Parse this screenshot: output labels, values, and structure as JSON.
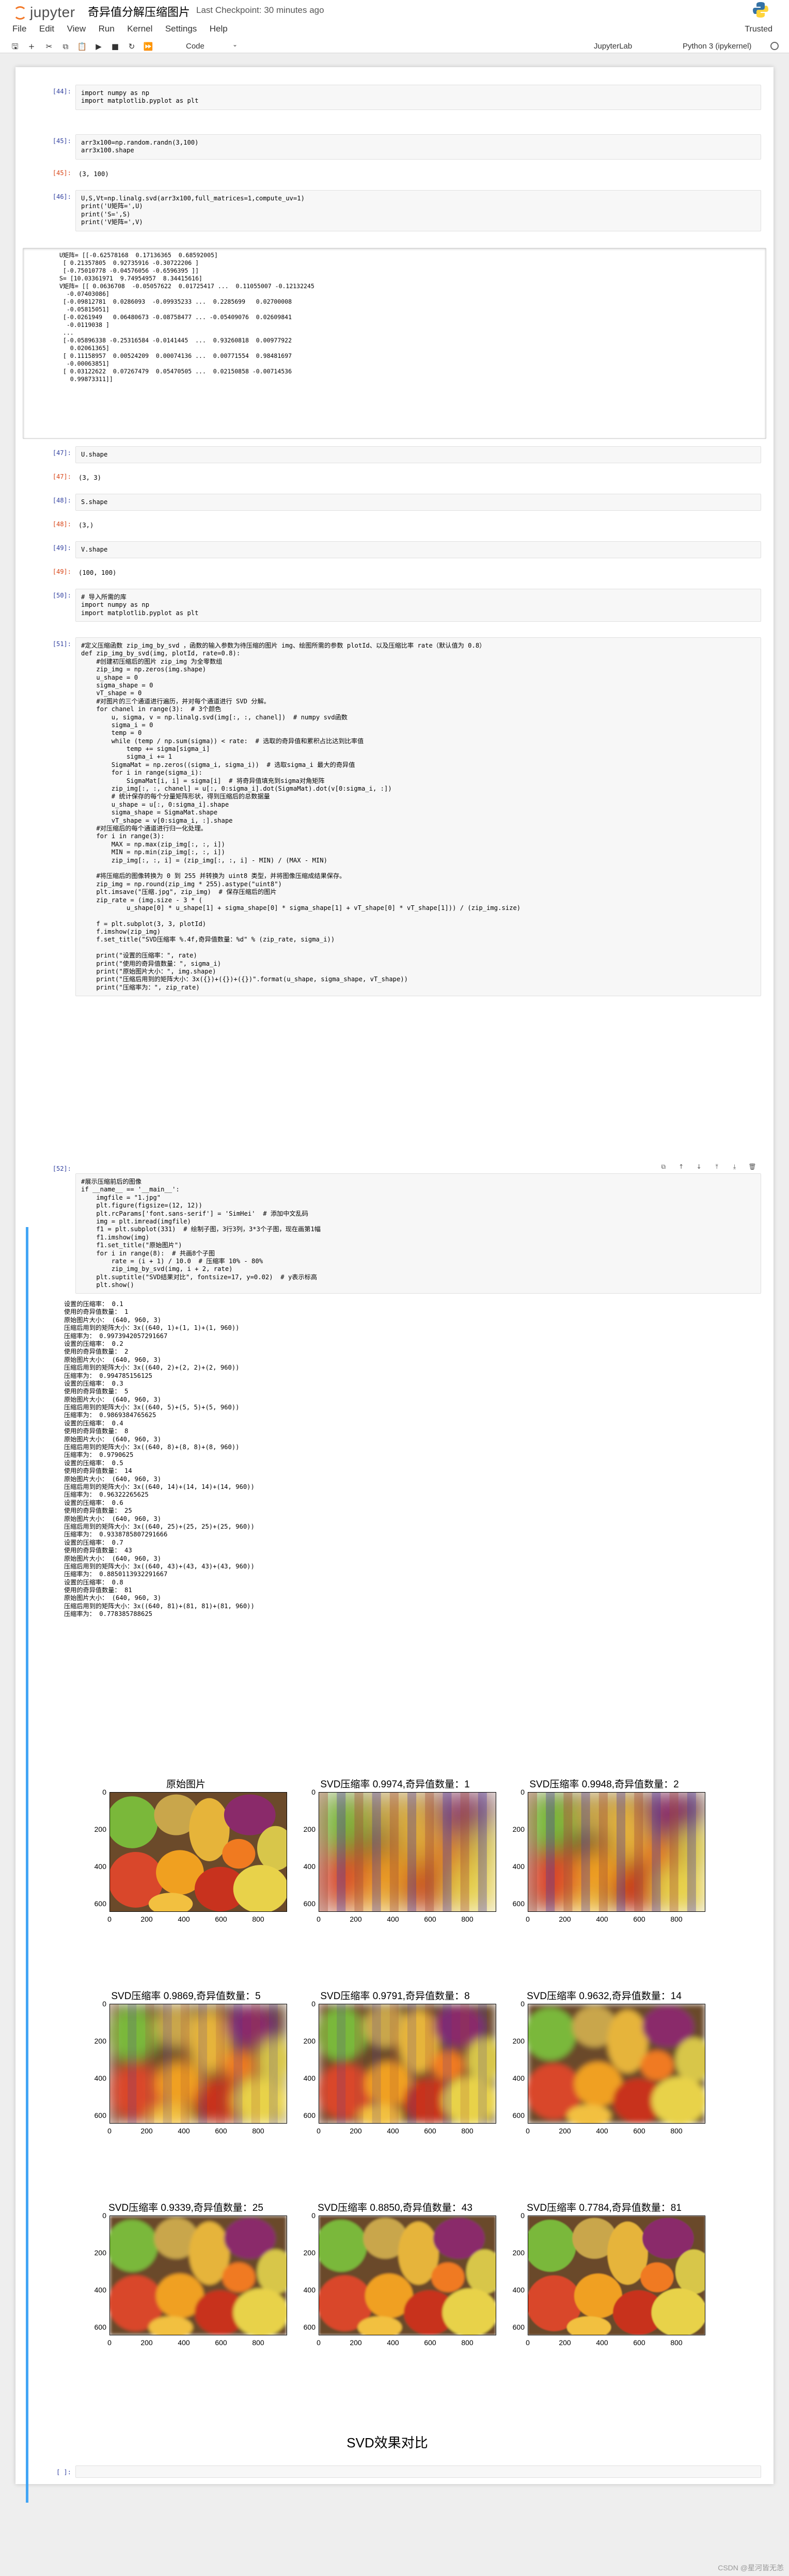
{
  "header": {
    "logo_text": "jupyter",
    "title": "奇异值分解压缩图片",
    "checkpoint": "Last Checkpoint: 30 minutes ago",
    "trusted": "Trusted",
    "menu": [
      "File",
      "Edit",
      "View",
      "Run",
      "Kernel",
      "Settings",
      "Help"
    ],
    "cell_type": "Code",
    "jupyterlab_link": "JupyterLab",
    "kernel": "Python 3 (ipykernel)"
  },
  "cells": {
    "c1": {
      "prompt": "[44]:",
      "lines": [
        "import numpy as np",
        "import matplotlib.pyplot as plt"
      ]
    },
    "c2": {
      "prompt": "[45]:",
      "lines": [
        "arr3x100=np.random.randn(3,100)",
        "arr3x100.shape"
      ]
    },
    "c2o": {
      "prompt": "[45]:",
      "lines": [
        "(3, 100)"
      ]
    },
    "c3": {
      "prompt": "[46]:",
      "lines": [
        "U,S,Vt=np.linalg.svd(arr3x100,full_matrices=1,compute_uv=1)",
        "print('U矩阵=',U)",
        "print('S=',S)",
        "print('V矩阵=',V)"
      ]
    },
    "c3o": {
      "lines": [
        "U矩阵= [[-0.62578168  0.17136365  0.68592005]",
        " [ 0.21357805  0.92735916 -0.30722206 ]",
        " [-0.75010778 -0.04576056 -0.6596395 ]]",
        "S= [10.03361971  9.74954957  8.34415616]",
        "V矩阵= [[ 0.0636708  -0.05057622  0.01725417 ...  0.11055007 -0.12132245",
        "  -0.07403086]",
        " [-0.09812781  0.0286093  -0.09935233 ...  0.2285699   0.02700008",
        "  -0.05815051]",
        " [-0.0261949   0.06480673 -0.08758477 ... -0.05409076  0.02609841",
        "  -0.0119038 ]",
        " ...",
        " [-0.05896338 -0.25316584 -0.0141445  ...  0.93260818  0.00977922",
        "   0.02061365]",
        " [ 0.11158957  0.00524209  0.00074136 ...  0.00771554  0.98481697",
        "  -0.00063851]",
        " [ 0.03122622  0.07267479  0.05470505 ...  0.02150858 -0.00714536",
        "   0.99873311]]"
      ]
    },
    "c4": {
      "prompt": "[47]:",
      "lines": [
        "U.shape"
      ]
    },
    "c4o": {
      "prompt": "[47]:",
      "lines": [
        "(3, 3)"
      ]
    },
    "c5": {
      "prompt": "[48]:",
      "lines": [
        "S.shape"
      ]
    },
    "c5o": {
      "prompt": "[48]:",
      "lines": [
        "(3,)"
      ]
    },
    "c6": {
      "prompt": "[49]:",
      "lines": [
        "V.shape"
      ]
    },
    "c6o": {
      "prompt": "[49]:",
      "lines": [
        "(100, 100)"
      ]
    },
    "c7": {
      "prompt": "[50]:",
      "lines": [
        "# 导入所需的库",
        "import numpy as np",
        "import matplotlib.pyplot as plt"
      ]
    },
    "c8": {
      "prompt": "[51]:",
      "lines": [
        "#定义压缩函数 zip_img_by_svd ，函数的输入参数为待压缩的图片 img、绘图所需的参数 plotId、以及压缩比率 rate（默认值为 0.8）",
        "def zip_img_by_svd(img, plotId, rate=0.8):",
        "    #创建初压缩后的图片 zip_img 为全零数组",
        "    zip_img = np.zeros(img.shape)",
        "    u_shape = 0",
        "    sigma_shape = 0",
        "    vT_shape = 0",
        "    #对图片的三个通道进行遍历，并对每个通道进行 SVD 分解。",
        "    for chanel in range(3):  # 3个颜色",
        "        u, sigma, v = np.linalg.svd(img[:, :, chanel])  # numpy svd函数",
        "        sigma_i = 0",
        "        temp = 0",
        "        while (temp / np.sum(sigma)) < rate:  # 选取的奇异值和累积占比达到比率值",
        "            temp += sigma[sigma_i]",
        "            sigma_i += 1",
        "        SigmaMat = np.zeros((sigma_i, sigma_i))  # 选取sigma_i 最大的奇异值",
        "        for i in range(sigma_i):",
        "            SigmaMat[i, i] = sigma[i]  # 将奇异值填充到sigma对角矩阵",
        "        zip_img[:, :, chanel] = u[:, 0:sigma_i].dot(SigmaMat).dot(v[0:sigma_i, :])",
        "        # 统计保存的每个分量矩阵形状，得到压缩后的总数据量",
        "        u_shape = u[:, 0:sigma_i].shape",
        "        sigma_shape = SigmaMat.shape",
        "        vT_shape = v[0:sigma_i, :].shape",
        "    #对压缩后的每个通道进行归一化处理。",
        "    for i in range(3):",
        "        MAX = np.max(zip_img[:, :, i])",
        "        MIN = np.min(zip_img[:, :, i])",
        "        zip_img[:, :, i] = (zip_img[:, :, i] - MIN) / (MAX - MIN)",
        "",
        "    #将压缩后的图像转换为 0 到 255 并转换为 uint8 类型，并将图像压缩成结果保存。",
        "    zip_img = np.round(zip_img * 255).astype(\"uint8\")",
        "    plt.imsave(\"压缩.jpg\", zip_img)  # 保存压缩后的图片",
        "    zip_rate = (img.size - 3 * (",
        "            u_shape[0] * u_shape[1] + sigma_shape[0] * sigma_shape[1] + vT_shape[0] * vT_shape[1])) / (zip_img.size)",
        "",
        "    f = plt.subplot(3, 3, plotId)",
        "    f.imshow(zip_img)",
        "    f.set_title(\"SVD压缩率 %.4f,奇异值数量：%d\" % (zip_rate, sigma_i))",
        "",
        "    print(\"设置的压缩率：\", rate)",
        "    print(\"使用的奇异值数量：\", sigma_i)",
        "    print(\"原始图片大小：\", img.shape)",
        "    print(\"压缩后用到的矩阵大小：3x({})+({})+({})\".format(u_shape, sigma_shape, vT_shape))",
        "    print(\"压缩率为：\", zip_rate)"
      ]
    },
    "c9": {
      "prompt": "[52]:",
      "lines": [
        "#展示压缩前后的图像",
        "if __name__ == '__main__':",
        "    imgfile = \"1.jpg\"",
        "    plt.figure(figsize=(12, 12))",
        "    plt.rcParams['font.sans-serif'] = 'SimHei'  # 添加中文乱码",
        "    img = plt.imread(imgfile)",
        "    f1 = plt.subplot(331)  # 绘制子图，3行3列，3*3个子图，现在画第1幅",
        "    f1.imshow(img)",
        "    f1.set_title(\"原始图片\")",
        "    for i in range(8):  # 共画8个子图",
        "        rate = (i + 1) / 10.0  # 压缩率 10% - 80%",
        "        zip_img_by_svd(img, i + 2, rate)",
        "    plt.suptitle(\"SVD结果对比\", fontsize=17, y=0.02)  # y表示标高",
        "    plt.show()"
      ]
    },
    "c9o": {
      "lines": [
        "设置的压缩率： 0.1",
        "使用的奇异值数量： 1",
        "原始图片大小： (640, 960, 3)",
        "压缩后用到的矩阵大小：3x((640, 1)+(1, 1)+(1, 960))",
        "压缩率为： 0.9973942057291667",
        "设置的压缩率： 0.2",
        "使用的奇异值数量： 2",
        "原始图片大小： (640, 960, 3)",
        "压缩后用到的矩阵大小：3x((640, 2)+(2, 2)+(2, 960))",
        "压缩率为： 0.994785156125",
        "设置的压缩率： 0.3",
        "使用的奇异值数量： 5",
        "原始图片大小： (640, 960, 3)",
        "压缩后用到的矩阵大小：3x((640, 5)+(5, 5)+(5, 960))",
        "压缩率为： 0.9869384765625",
        "设置的压缩率： 0.4",
        "使用的奇异值数量： 8",
        "原始图片大小： (640, 960, 3)",
        "压缩后用到的矩阵大小：3x((640, 8)+(8, 8)+(8, 960))",
        "压缩率为： 0.9790625",
        "设置的压缩率： 0.5",
        "使用的奇异值数量： 14",
        "原始图片大小： (640, 960, 3)",
        "压缩后用到的矩阵大小：3x((640, 14)+(14, 14)+(14, 960))",
        "压缩率为： 0.96322265625",
        "设置的压缩率： 0.6",
        "使用的奇异值数量： 25",
        "原始图片大小： (640, 960, 3)",
        "压缩后用到的矩阵大小：3x((640, 25)+(25, 25)+(25, 960))",
        "压缩率为： 0.9338785807291666",
        "设置的压缩率： 0.7",
        "使用的奇异值数量： 43",
        "原始图片大小： (640, 960, 3)",
        "压缩后用到的矩阵大小：3x((640, 43)+(43, 43)+(43, 960))",
        "压缩率为： 0.8850113932291667",
        "设置的压缩率： 0.8",
        "使用的奇异值数量： 81",
        "原始图片大小： (640, 960, 3)",
        "压缩后用到的矩阵大小：3x((640, 81)+(81, 81)+(81, 960))",
        "压缩率为： 0.778385788625"
      ]
    },
    "c10": {
      "prompt": "[ ]:"
    }
  },
  "figure": {
    "suptitle": "SVD效果对比",
    "subplots": [
      {
        "title": "原始图片",
        "blur": 0
      },
      {
        "title": "SVD压缩率 0.9974,奇异值数量：1",
        "blur": 26
      },
      {
        "title": "SVD压缩率 0.9948,奇异值数量：2",
        "blur": 20
      },
      {
        "title": "SVD压缩率 0.9869,奇异值数量：5",
        "blur": 12
      },
      {
        "title": "SVD压缩率 0.9791,奇异值数量：8",
        "blur": 8
      },
      {
        "title": "SVD压缩率 0.9632,奇异值数量：14",
        "blur": 5
      },
      {
        "title": "SVD压缩率 0.9339,奇异值数量：25",
        "blur": 3
      },
      {
        "title": "SVD压缩率 0.8850,奇异值数量：43",
        "blur": 2
      },
      {
        "title": "SVD压缩率 0.7784,奇异值数量：81",
        "blur": 1
      }
    ],
    "yticks": [
      "0",
      "200",
      "400",
      "600"
    ],
    "xticks": [
      "0",
      "200",
      "400",
      "600",
      "800"
    ]
  },
  "footer": "CSDN @星河皆无恙",
  "colors": {
    "prompt_in": "#303f9f",
    "prompt_out": "#d84315",
    "selected_bar": "#42a5f5",
    "jupyter_orange": "#f37726"
  }
}
